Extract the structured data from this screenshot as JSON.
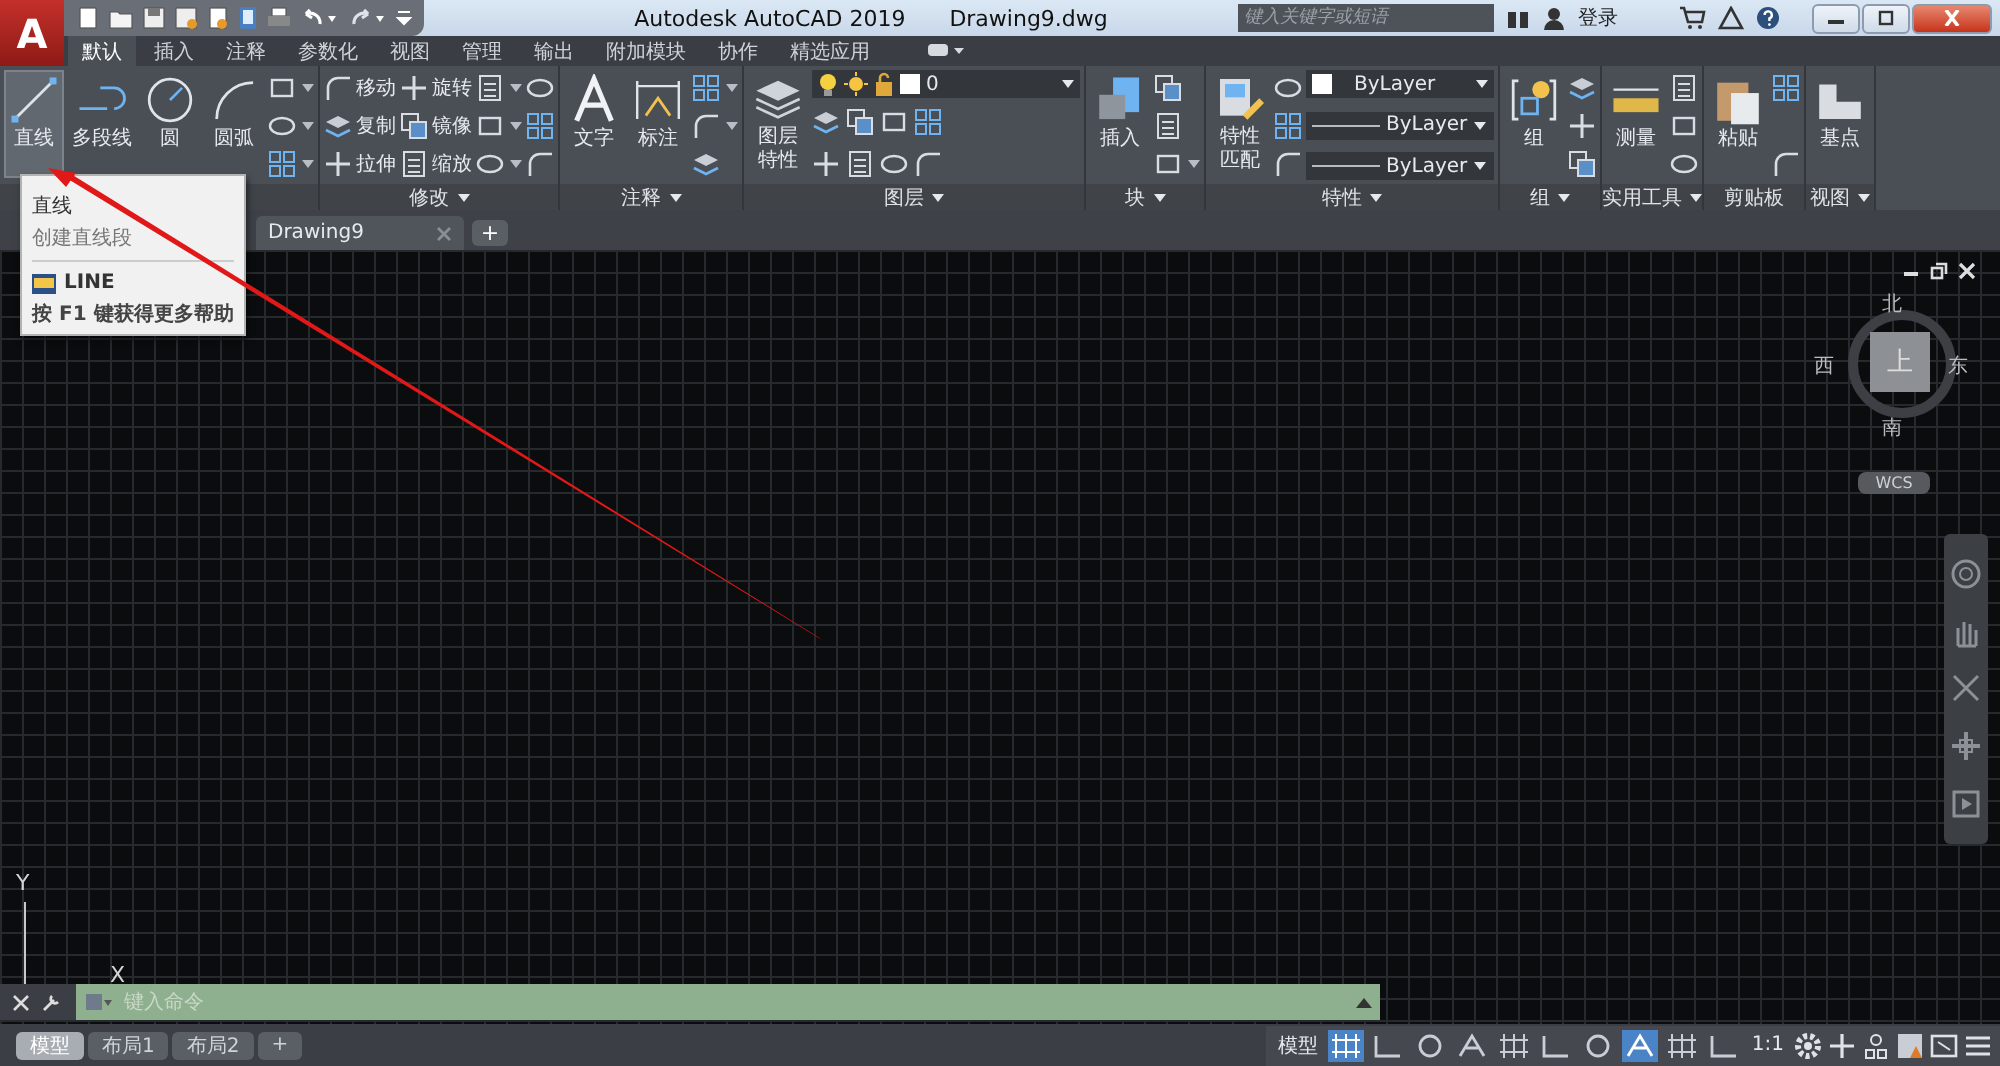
{
  "title_bar": {
    "app_letter": "A",
    "title": "Autodesk AutoCAD 2019",
    "document": "Drawing9.dwg",
    "search_placeholder": "键入关键字或短语",
    "login": "登录"
  },
  "ribbon_tabs": [
    {
      "label": "默认",
      "selected": true
    },
    {
      "label": "插入",
      "selected": false
    },
    {
      "label": "注释",
      "selected": false
    },
    {
      "label": "参数化",
      "selected": false
    },
    {
      "label": "视图",
      "selected": false
    },
    {
      "label": "管理",
      "selected": false
    },
    {
      "label": "输出",
      "selected": false
    },
    {
      "label": "附加模块",
      "selected": false
    },
    {
      "label": "协作",
      "selected": false
    },
    {
      "label": "精选应用",
      "selected": false
    }
  ],
  "ribbon_panels": [
    {
      "menu": false,
      "columns": [
        [
          {
            "kind": "large",
            "label": "直线",
            "highlighted": true
          }
        ],
        [
          {
            "kind": "large",
            "label": "多段线",
            "highlighted": false
          }
        ],
        [
          {
            "kind": "large",
            "label": "圆",
            "highlighted": false
          }
        ],
        [
          {
            "kind": "large",
            "label": "圆弧",
            "highlighted": false
          }
        ],
        [
          {
            "kind": "icon",
            "caret": true
          },
          {
            "kind": "icon",
            "caret": true
          },
          {
            "kind": "icon",
            "caret": true
          }
        ]
      ]
    },
    {
      "title": "修改",
      "menu": true,
      "columns": [
        [
          {
            "kind": "small",
            "label": "移动"
          },
          {
            "kind": "small",
            "label": "复制"
          },
          {
            "kind": "small",
            "label": "拉伸"
          }
        ],
        [
          {
            "kind": "small",
            "label": "旋转"
          },
          {
            "kind": "small",
            "label": "镜像"
          },
          {
            "kind": "small",
            "label": "缩放"
          }
        ],
        [
          {
            "kind": "icon",
            "caret": true
          },
          {
            "kind": "icon",
            "caret": true
          },
          {
            "kind": "icon",
            "caret": true
          }
        ],
        [
          {
            "kind": "icon",
            "caret": false
          },
          {
            "kind": "icon",
            "caret": false
          },
          {
            "kind": "icon",
            "caret": false
          }
        ]
      ]
    },
    {
      "title": "注释",
      "menu": true,
      "columns": [
        [
          {
            "kind": "large",
            "label": "文字",
            "highlighted": false
          }
        ],
        [
          {
            "kind": "large",
            "label": "标注",
            "highlighted": false
          }
        ],
        [
          {
            "kind": "icon",
            "caret": true
          },
          {
            "kind": "icon",
            "caret": true
          },
          {
            "kind": "icon",
            "caret": false
          }
        ]
      ]
    },
    {
      "title": "图层",
      "menu": true,
      "columns": [
        [
          {
            "kind": "large",
            "label": "图层特性",
            "highlighted": false
          }
        ],
        [
          {
            "kind": "layerselect",
            "value": "0"
          },
          {
            "kind": "iconrow"
          },
          {
            "kind": "iconrow"
          }
        ]
      ]
    },
    {
      "title": "块",
      "menu": true,
      "columns": [
        [
          {
            "kind": "large",
            "label": "插入",
            "highlighted": false
          }
        ],
        [
          {
            "kind": "icon",
            "caret": false
          },
          {
            "kind": "icon",
            "caret": false
          },
          {
            "kind": "icon",
            "caret": true
          }
        ]
      ]
    },
    {
      "title": "特性",
      "menu": true,
      "columns": [
        [
          {
            "kind": "large",
            "label": "特性匹配",
            "highlighted": false
          }
        ],
        [
          {
            "kind": "icon",
            "caret": false
          },
          {
            "kind": "icon",
            "caret": false
          },
          {
            "kind": "icon",
            "caret": false
          }
        ],
        [
          {
            "kind": "colorselect",
            "value": "ByLayer"
          },
          {
            "kind": "lineselect",
            "value": "ByLayer"
          },
          {
            "kind": "lineselect",
            "value": "ByLayer"
          }
        ]
      ]
    },
    {
      "title": "组",
      "menu": true,
      "columns": [
        [
          {
            "kind": "large",
            "label": "组",
            "highlighted": false
          }
        ],
        [
          {
            "kind": "icon",
            "caret": false
          },
          {
            "kind": "icon",
            "caret": false
          },
          {
            "kind": "icon",
            "caret": false
          }
        ]
      ]
    },
    {
      "title": "实用工具",
      "menu": true,
      "columns": [
        [
          {
            "kind": "large",
            "label": "测量",
            "highlighted": false
          }
        ],
        [
          {
            "kind": "icon",
            "caret": false
          },
          {
            "kind": "icon",
            "caret": false
          },
          {
            "kind": "icon",
            "caret": false
          }
        ]
      ]
    },
    {
      "title": "剪贴板",
      "menu": false,
      "columns": [
        [
          {
            "kind": "large",
            "label": "粘贴",
            "highlighted": false
          }
        ],
        [
          {
            "kind": "icon",
            "caret": false
          },
          {
            "kind": "icon",
            "caret": false
          }
        ]
      ]
    },
    {
      "title": "视图",
      "menu": true,
      "columns": [
        [
          {
            "kind": "large",
            "label": "基点",
            "highlighted": false
          }
        ]
      ]
    }
  ],
  "file_tabs": [
    {
      "label": "Drawing9",
      "selected": true
    }
  ],
  "new_tab": "+",
  "tooltip": {
    "title": "直线",
    "description": "创建直线段",
    "command": "LINE",
    "help": "按 F1 键获得更多帮助"
  },
  "viewcube": {
    "north": "北",
    "west": "西",
    "face": "上",
    "east": "东",
    "south": "南",
    "ucs": "WCS"
  },
  "ucs_icon": {
    "y": "Y",
    "x": "X"
  },
  "command_line": {
    "placeholder": "键入命令"
  },
  "layout_tabs": [
    {
      "label": "模型",
      "selected": true
    },
    {
      "label": "布局1",
      "selected": false
    },
    {
      "label": "布局2",
      "selected": false
    }
  ],
  "new_layout": "+",
  "status_bar": {
    "space": "模型",
    "scale": "1:1",
    "toggles": [
      {
        "on": true
      },
      {
        "on": false
      },
      {
        "on": false
      },
      {
        "on": false
      },
      {
        "on": false
      },
      {
        "on": false
      },
      {
        "on": false
      },
      {
        "on": true
      },
      {
        "on": false
      },
      {
        "on": false
      }
    ]
  }
}
